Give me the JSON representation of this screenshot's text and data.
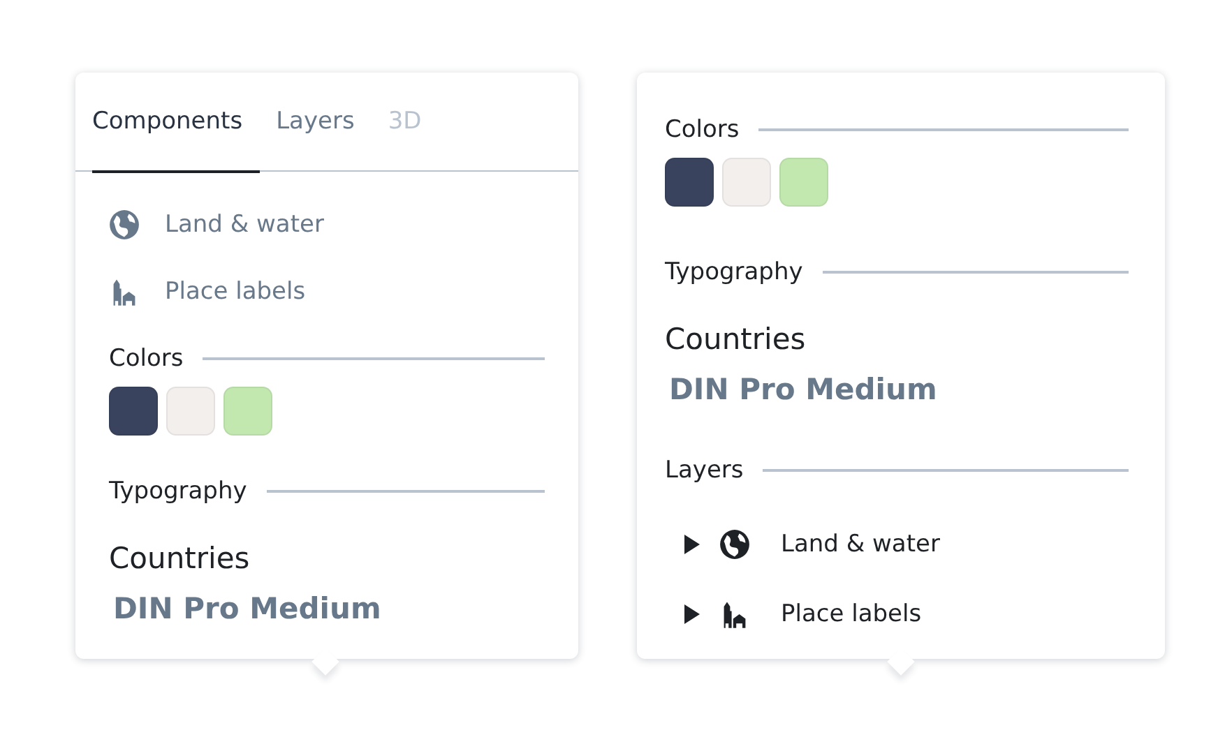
{
  "panels": [
    {
      "tabs": [
        {
          "label": "Components",
          "selected": true,
          "disabled": false
        },
        {
          "label": "Layers",
          "selected": false,
          "disabled": false
        },
        {
          "label": "3D",
          "selected": false,
          "disabled": true
        }
      ],
      "sections": [
        {
          "kind": "items",
          "items": [
            {
              "kind": "globe",
              "label": "Land & water"
            },
            {
              "kind": "buildings",
              "label": "Place labels"
            }
          ]
        },
        {
          "kind": "colors",
          "heading": "Colors",
          "swatches": [
            {
              "color": "#3a435e"
            },
            {
              "color": "#f2efed"
            },
            {
              "color": "#c2e8b0"
            }
          ]
        },
        {
          "kind": "typography",
          "heading": "Typography",
          "style_name": "Countries",
          "font_name": "DIN Pro Medium"
        }
      ]
    },
    {
      "sections": [
        {
          "kind": "colors",
          "heading": "Colors",
          "swatches": [
            {
              "color": "#3a435e"
            },
            {
              "color": "#f2efed"
            },
            {
              "color": "#c2e8b0"
            }
          ]
        },
        {
          "kind": "typography",
          "heading": "Typography",
          "style_name": "Countries",
          "font_name": "DIN Pro Medium"
        },
        {
          "kind": "layers",
          "heading": "Layers",
          "items": [
            {
              "kind": "globe",
              "label": "Land & water",
              "expanded": false
            },
            {
              "kind": "buildings",
              "label": "Place labels",
              "expanded": false
            }
          ]
        }
      ]
    }
  ]
}
